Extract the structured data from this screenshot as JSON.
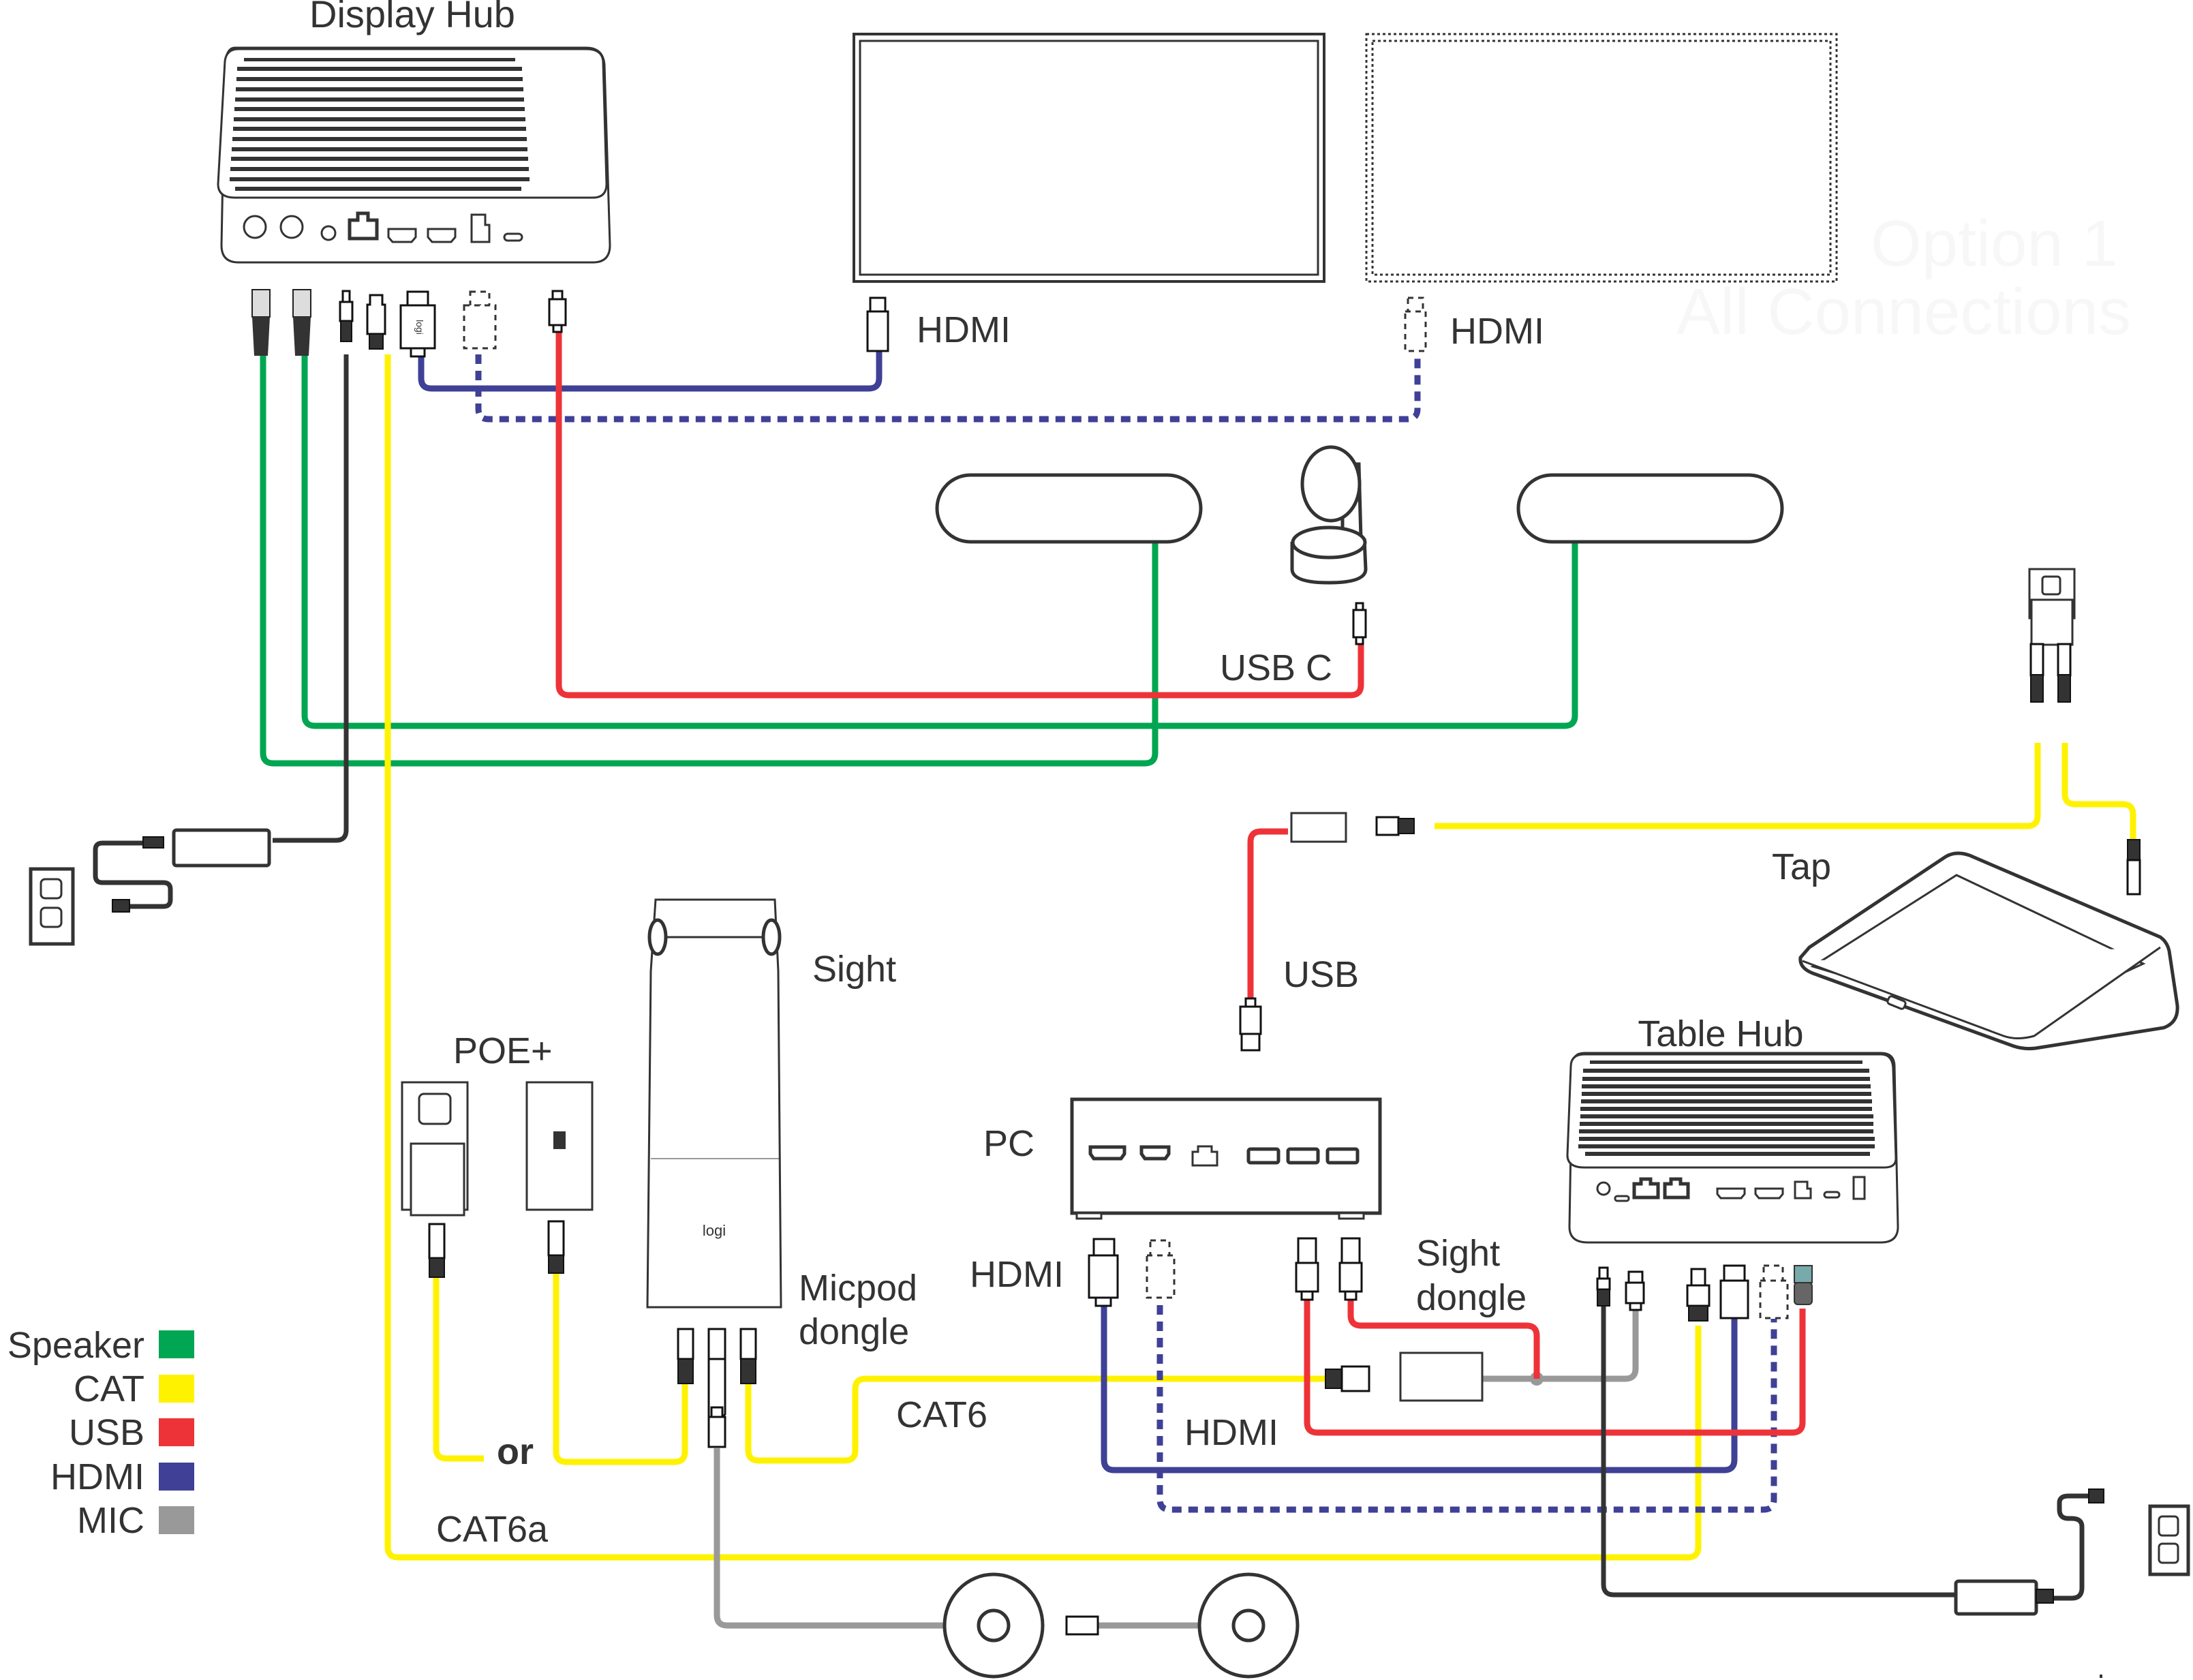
{
  "title": "Option 1",
  "subtitle": "All Connections",
  "devices": {
    "display_hub": "Display Hub",
    "table_hub": "Table Hub",
    "pc": "PC",
    "sight": "Sight",
    "tap": "Tap",
    "poe": "POE+",
    "micpod_dongle": "Micpod\ndongle",
    "micpod_dongle_lines": [
      "Micpod",
      "dongle"
    ],
    "sight_dongle_lines": [
      "Sight",
      "dongle"
    ]
  },
  "cable_labels": {
    "hdmi_display1": "HDMI",
    "hdmi_display2": "HDMI",
    "usb_c": "USB C",
    "usb": "USB",
    "hdmi_pc": "HDMI",
    "hdmi_bottom": "HDMI",
    "cat6": "CAT6",
    "cat6a": "CAT6a",
    "or": "or"
  },
  "logo_text": "logi",
  "legend": [
    {
      "label": "Speaker",
      "color": "#00A651"
    },
    {
      "label": "CAT",
      "color": "#FFF200"
    },
    {
      "label": "USB",
      "color": "#EE3338"
    },
    {
      "label": "HDMI",
      "color": "#3F4096"
    },
    {
      "label": "MIC",
      "color": "#999999"
    }
  ],
  "colors": {
    "speaker": "#00A651",
    "cat": "#FFF200",
    "usb": "#EE3338",
    "hdmi": "#3F4096",
    "mic": "#999999",
    "power": "#333333",
    "outline": "#333333"
  }
}
